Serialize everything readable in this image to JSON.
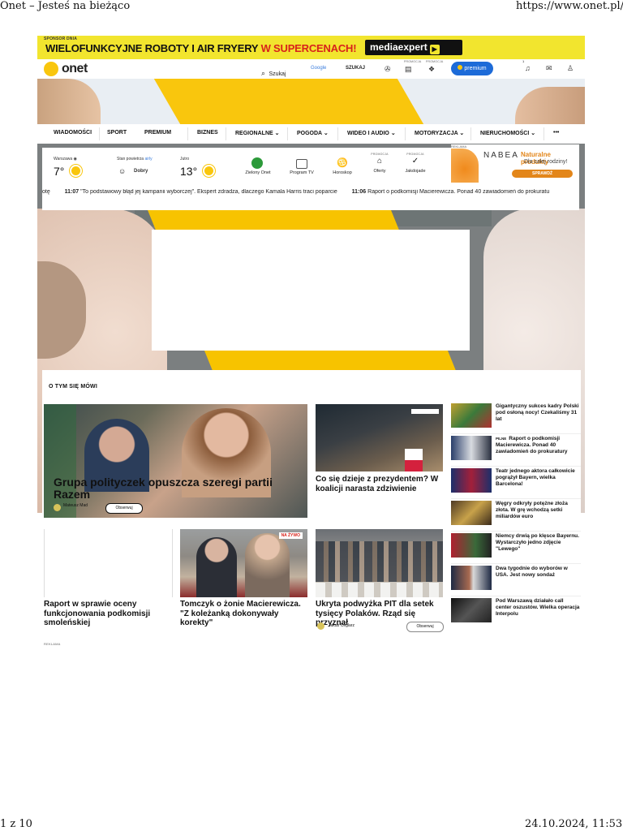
{
  "print_header": {
    "title": "Onet – Jesteś na bieżąco",
    "url": "https://www.onet.pl/"
  },
  "print_footer": {
    "page": "1 z 10",
    "datetime": "24.10.2024, 11:53"
  },
  "sponsor": {
    "label": "SPONSOR DNIA",
    "text_main": "WIELOFUNKCYJNE ROBOTY I AIR FRYERY",
    "text_red": "W SUPERCENACH!",
    "brand": "mediaexpert",
    "brand_color": "#111111",
    "bg_color": "#f2e52e"
  },
  "topbar": {
    "logo": "onet",
    "search": "Szukaj",
    "google": "Google",
    "google_search": "SZUKAJ",
    "promo_label": "PROMOCJA",
    "premium": "premium",
    "notification_count": "1"
  },
  "nav": {
    "items": [
      {
        "label": "WIADOMOŚCI"
      },
      {
        "label": "SPORT"
      },
      {
        "label": "PREMIUM"
      },
      {
        "label": "BIZNES"
      },
      {
        "label": "REGIONALNE"
      },
      {
        "label": "POGODA"
      },
      {
        "label": "WIDEO I AUDIO"
      },
      {
        "label": "MOTORYZACJA"
      },
      {
        "label": "NIERUCHOMOŚCI"
      },
      {
        "label": "•••"
      }
    ]
  },
  "widgets": {
    "city": "Warszawa",
    "temp_now": "7°",
    "air_label": "Stan powietrza",
    "air_source": "airly",
    "air_value": "Dobry",
    "tomorrow_label": "Jutro",
    "temp_tomorrow": "13°",
    "links": [
      {
        "label": "Zielony Onet"
      },
      {
        "label": "Program TV"
      },
      {
        "label": "Horoskop"
      },
      {
        "label": "Oferty",
        "promo": "PROMOCJA"
      },
      {
        "label": "Jakdojade",
        "promo": "PROMOCJA"
      }
    ],
    "ad": {
      "label": "REKLAMA",
      "logo": "NABEA",
      "headline": "Naturalne produkty",
      "sub": "Dla całej rodziny!",
      "cta": "SPRAWDŹ"
    }
  },
  "ticker": {
    "lead": "otę",
    "items": [
      {
        "time": "11:07",
        "text": "\"To podstawowy błąd jej kampanii wyborczej\". Ekspert zdradza, dlaczego Kamala Harris traci poparcie"
      },
      {
        "time": "11:06",
        "text": "Raport o podkomisji Macierewicza. Ponad 40 zawiadomień do prokuratu"
      }
    ]
  },
  "section": {
    "heading": "O TYM SIĘ MÓWI",
    "lead": {
      "title": "Grupa polityczek opuszcza szeregi partii Razem",
      "author": "Mateusz Mad",
      "follow": "Obserwuj"
    },
    "card2": {
      "title": "Co się dzieje z prezydentem? W koalicji narasta zdziwienie"
    },
    "side": [
      {
        "pilne": "",
        "title": "Gigantyczny sukces kadry Polski pod osłoną nocy! Czekaliśmy 31 lat"
      },
      {
        "pilne": "PILNE",
        "title": "Raport o podkomisji Macierewicza. Ponad 40 zawiadomień do prokuratury"
      },
      {
        "pilne": "",
        "title": "Teatr jednego aktora całkowicie pogrążył Bayern, wielka Barcelona!"
      },
      {
        "pilne": "",
        "title": "Węgry odkryły potężne złoża złota. W grę wchodzą setki miliardów euro"
      },
      {
        "pilne": "",
        "title": "Niemcy drwią po klęsce Bayernu. Wystarczyło jedno zdjęcie \"Lewego\""
      },
      {
        "pilne": "",
        "title": "Dwa tygodnie do wyborów w USA. Jest nowy sondaż"
      },
      {
        "pilne": "",
        "title": "Pod Warszawą działało call center oszustów. Wielka operacja Interpolu"
      }
    ],
    "card4": {
      "title": "Raport w sprawie oceny funkcjonowania podkomisji smoleńskiej"
    },
    "card5": {
      "title": "Tomczyk o żonie Macierewicza. \"Z koleżanką dokonywały korekty\"",
      "badge": "NA ŻYWO"
    },
    "card6": {
      "title": "Ukryta podwyżka PIT dla setek tysięcy Polaków. Rząd się przyznał",
      "author": "Jakub Ceglarz",
      "follow": "Obserwuj"
    },
    "reklama": "REKLAMA"
  }
}
